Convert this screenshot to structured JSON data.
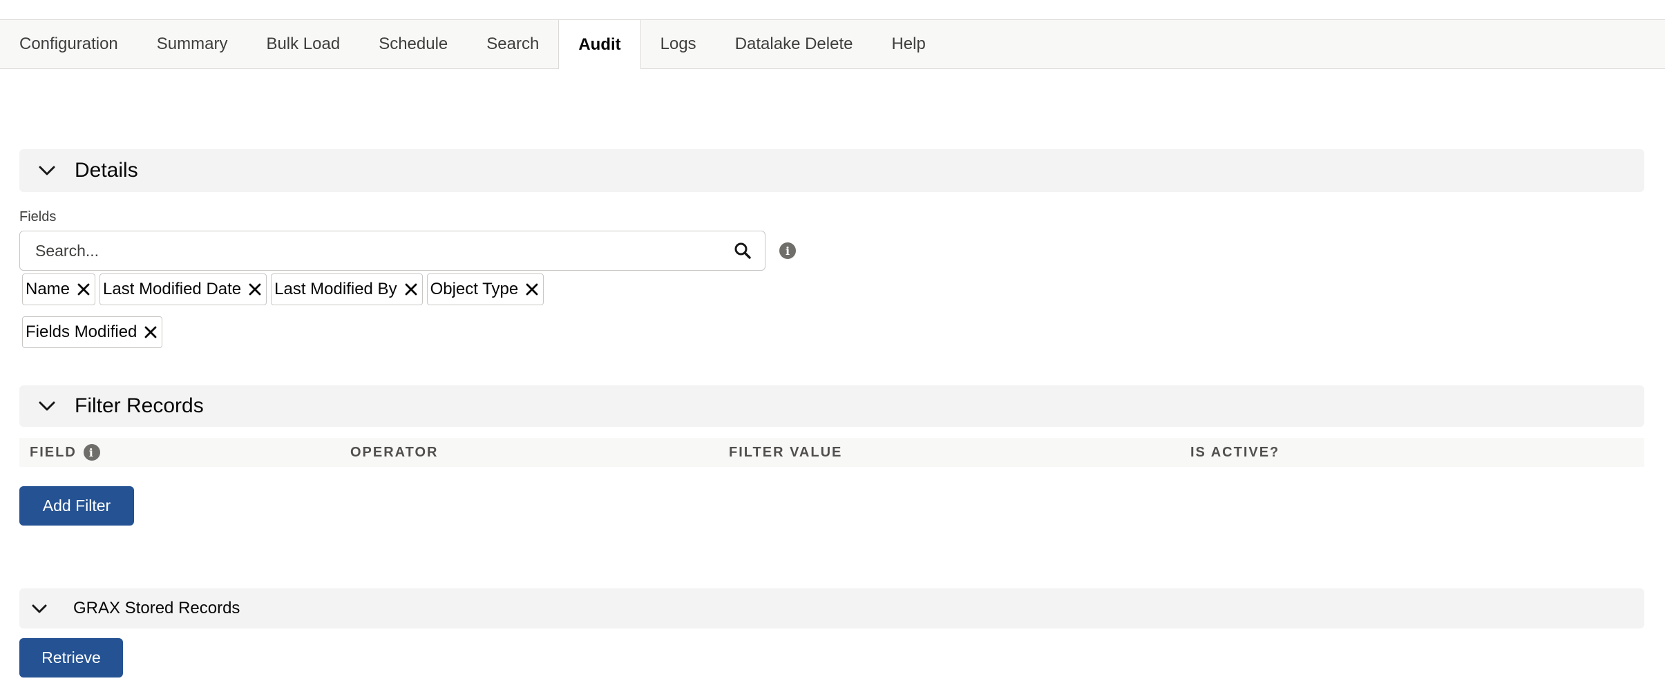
{
  "tabs": [
    {
      "label": "Configuration"
    },
    {
      "label": "Summary"
    },
    {
      "label": "Bulk Load"
    },
    {
      "label": "Schedule"
    },
    {
      "label": "Search"
    },
    {
      "label": "Audit"
    },
    {
      "label": "Logs"
    },
    {
      "label": "Datalake Delete"
    },
    {
      "label": "Help"
    }
  ],
  "active_tab": "Audit",
  "details": {
    "title": "Details",
    "fields_label": "Fields",
    "search_placeholder": "Search...",
    "search_icon": "search-icon",
    "info_icon": "info-icon",
    "selected_fields": [
      "Name",
      "Last Modified Date",
      "Last Modified By",
      "Object Type",
      "Fields Modified"
    ]
  },
  "filter_records": {
    "title": "Filter Records",
    "columns": {
      "field": "FIELD",
      "operator": "OPERATOR",
      "filter_value": "FILTER VALUE",
      "is_active": "IS ACTIVE?"
    },
    "add_filter_label": "Add Filter"
  },
  "stored_records": {
    "title": "GRAX Stored Records",
    "retrieve_label": "Retrieve"
  },
  "colors": {
    "brand_button": "#245293",
    "section_bg": "#f3f3f3",
    "tabbar_bg": "#f8f8f7"
  }
}
